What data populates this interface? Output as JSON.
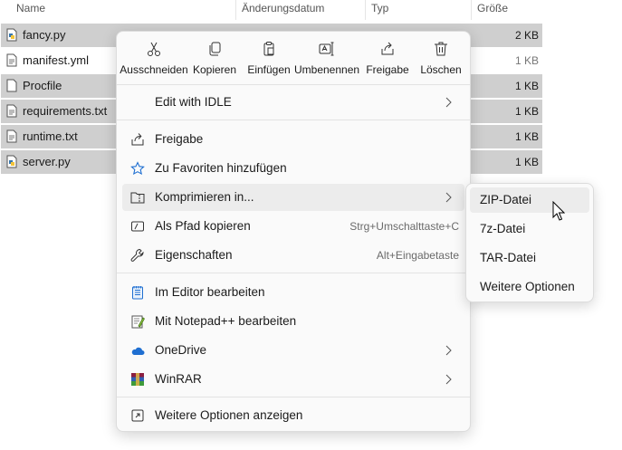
{
  "columns": {
    "name": "Name",
    "date": "Änderungsdatum",
    "type": "Typ",
    "size": "Größe"
  },
  "files": [
    {
      "name": "fancy.py",
      "size": "2 KB",
      "icon": "python-file-icon"
    },
    {
      "name": "manifest.yml",
      "size": "1 KB",
      "icon": "text-file-icon"
    },
    {
      "name": "Procfile",
      "size": "1 KB",
      "icon": "blank-file-icon"
    },
    {
      "name": "requirements.txt",
      "size": "1 KB",
      "icon": "text-file-icon"
    },
    {
      "name": "runtime.txt",
      "size": "1 KB",
      "icon": "text-file-icon"
    },
    {
      "name": "server.py",
      "size": "1 KB",
      "icon": "python-file-icon"
    }
  ],
  "toolbar": {
    "cut": "Ausschneiden",
    "copy": "Kopieren",
    "paste": "Einfügen",
    "rename": "Umbenennen",
    "share": "Freigabe",
    "delete": "Löschen"
  },
  "menu": {
    "edit_idle": "Edit with IDLE",
    "share": "Freigabe",
    "favorites": "Zu Favoriten hinzufügen",
    "compress": "Komprimieren in...",
    "copy_path": "Als Pfad kopieren",
    "copy_path_shortcut": "Strg+Umschalttaste+C",
    "properties": "Eigenschaften",
    "properties_shortcut": "Alt+Eingabetaste",
    "edit_editor": "Im Editor bearbeiten",
    "notepadpp": "Mit Notepad++ bearbeiten",
    "onedrive": "OneDrive",
    "winrar": "WinRAR",
    "more_options": "Weitere Optionen anzeigen"
  },
  "submenu": {
    "zip": "ZIP-Datei",
    "sevenz": "7z-Datei",
    "tar": "TAR-Datei",
    "more": "Weitere Optionen"
  },
  "colors": {
    "accent": "#1f6fd1",
    "selected_row": "#cfcfcf",
    "hover": "#ececec",
    "menu_bg": "#fafafa"
  }
}
